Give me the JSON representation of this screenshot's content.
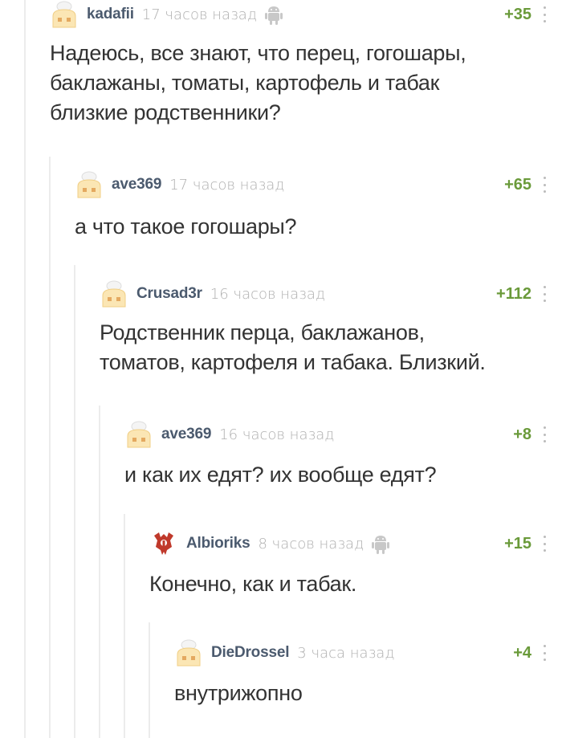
{
  "comments": [
    {
      "author": "kadafii",
      "time": "17 часов назад",
      "rating": "+35",
      "device_icon": "android-icon",
      "avatar_icon": "default-avatar-icon",
      "body": "Надеюсь, все знают, что перец, гогошары,\nбаклажаны, томаты, картофель и табак\nблизкие родственники?"
    },
    {
      "author": "ave369",
      "time": "17 часов назад",
      "rating": "+65",
      "avatar_icon": "default-avatar-icon",
      "body": "а что такое гогошары?"
    },
    {
      "author": "Crusad3r",
      "time": "16 часов назад",
      "rating": "+112",
      "avatar_icon": "default-avatar-icon",
      "body": "Родственник перца, баклажанов,\nтоматов, картофеля и табака. Близкий."
    },
    {
      "author": "ave369",
      "time": "16 часов назад",
      "rating": "+8",
      "avatar_icon": "default-avatar-icon",
      "body": "и как их едят? их вообще едят?"
    },
    {
      "author": "Albioriks",
      "time": "8 часов назад",
      "rating": "+15",
      "device_icon": "android-icon",
      "avatar_icon": "horde-emblem-icon",
      "body": "Конечно, как и табак."
    },
    {
      "author": "DieDrossel",
      "time": "3 часа назад",
      "rating": "+4",
      "avatar_icon": "default-avatar-icon",
      "body": "внутрижопно"
    }
  ],
  "colors": {
    "author": "#4b5a6e",
    "time": "#b0b0b0",
    "rating": "#6a9a3a",
    "text": "#333333",
    "thread_line": "#ececec"
  }
}
